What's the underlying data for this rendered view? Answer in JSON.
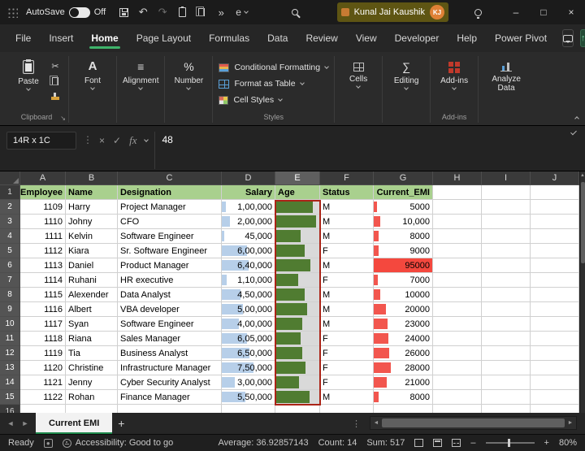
{
  "title_bar": {
    "autosave_label": "AutoSave",
    "autosave_state": "Off",
    "overflow_label": "e",
    "user_name": "Kunal Jai Kaushik",
    "user_initials": "KJ"
  },
  "menu": {
    "tabs": [
      "File",
      "Insert",
      "Home",
      "Page Layout",
      "Formulas",
      "Data",
      "Review",
      "View",
      "Developer",
      "Help",
      "Power Pivot"
    ],
    "active_index": 2
  },
  "ribbon": {
    "paste": "Paste",
    "font": "Font",
    "alignment": "Alignment",
    "number": "Number",
    "conditional_formatting": "Conditional Formatting",
    "format_as_table": "Format as Table",
    "cell_styles": "Cell Styles",
    "cells": "Cells",
    "editing": "Editing",
    "addins": "Add-ins",
    "analyze_data": "Analyze Data",
    "group_clipboard": "Clipboard",
    "group_styles": "Styles",
    "group_addins": "Add-ins"
  },
  "formula_bar": {
    "name_box": "14R x 1C",
    "fx_label": "fx",
    "value": "48"
  },
  "grid": {
    "columns": [
      "A",
      "B",
      "C",
      "D",
      "E",
      "F",
      "G",
      "H",
      "I",
      "J"
    ],
    "selected_column": "E",
    "selected_rows_from": 2,
    "selected_rows_to": 15,
    "header_row": [
      "Employee",
      "Name",
      "Designation",
      "Salary",
      "Age",
      "Status",
      "Current_EMI"
    ],
    "rows": [
      {
        "employee": "1109",
        "name": "Harry",
        "designation": "Project Manager",
        "salary": "1,00,000",
        "salary_bar": 8,
        "age_bar": 86,
        "status": "M",
        "emi": "5000",
        "emi_bar": 5
      },
      {
        "employee": "1110",
        "name": "Johny",
        "designation": "CFO",
        "salary": "2,00,000",
        "salary_bar": 16,
        "age_bar": 92,
        "status": "M",
        "emi": "10,000",
        "emi_bar": 11
      },
      {
        "employee": "1111",
        "name": "Kelvin",
        "designation": "Software Engineer",
        "salary": "45,000",
        "salary_bar": 4,
        "age_bar": 58,
        "status": "M",
        "emi": "8000",
        "emi_bar": 8
      },
      {
        "employee": "1112",
        "name": "Kiara",
        "designation": "Sr. Software Engineer",
        "salary": "6,00,000",
        "salary_bar": 48,
        "age_bar": 66,
        "status": "F",
        "emi": "9000",
        "emi_bar": 9
      },
      {
        "employee": "1113",
        "name": "Daniel",
        "designation": "Product Manager",
        "salary": "6,40,000",
        "salary_bar": 51,
        "age_bar": 80,
        "status": "M",
        "emi": "95000",
        "emi_bar": 100,
        "emi_full": true
      },
      {
        "employee": "1114",
        "name": "Ruhani",
        "designation": "HR executive",
        "salary": "1,10,000",
        "salary_bar": 9,
        "age_bar": 52,
        "status": "F",
        "emi": "7000",
        "emi_bar": 7
      },
      {
        "employee": "1115",
        "name": "Alexender",
        "designation": "Data Analyst",
        "salary": "4,50,000",
        "salary_bar": 36,
        "age_bar": 66,
        "status": "M",
        "emi": "10000",
        "emi_bar": 11
      },
      {
        "employee": "1116",
        "name": "Albert",
        "designation": "VBA developer",
        "salary": "5,00,000",
        "salary_bar": 40,
        "age_bar": 72,
        "status": "M",
        "emi": "20000",
        "emi_bar": 21
      },
      {
        "employee": "1117",
        "name": "Syan",
        "designation": "Software Engineer",
        "salary": "4,00,000",
        "salary_bar": 32,
        "age_bar": 62,
        "status": "M",
        "emi": "23000",
        "emi_bar": 24
      },
      {
        "employee": "1118",
        "name": "Riana",
        "designation": "Sales Manager",
        "salary": "6,05,000",
        "salary_bar": 48,
        "age_bar": 58,
        "status": "F",
        "emi": "24000",
        "emi_bar": 25
      },
      {
        "employee": "1119",
        "name": "Tia",
        "designation": "Business Analyst",
        "salary": "6,50,000",
        "salary_bar": 52,
        "age_bar": 62,
        "status": "F",
        "emi": "26000",
        "emi_bar": 27
      },
      {
        "employee": "1120",
        "name": "Christine",
        "designation": "Infrastructure Manager",
        "salary": "7,50,000",
        "salary_bar": 60,
        "age_bar": 68,
        "status": "F",
        "emi": "28000",
        "emi_bar": 29
      },
      {
        "employee": "1121",
        "name": "Jenny",
        "designation": "Cyber Security Analyst",
        "salary": "3,00,000",
        "salary_bar": 24,
        "age_bar": 54,
        "status": "F",
        "emi": "21000",
        "emi_bar": 22
      },
      {
        "employee": "1122",
        "name": "Rohan",
        "designation": "Finance Manager",
        "salary": "5,50,000",
        "salary_bar": 44,
        "age_bar": 78,
        "status": "M",
        "emi": "8000",
        "emi_bar": 8
      }
    ]
  },
  "sheet_bar": {
    "active_tab": "Current EMI"
  },
  "status_bar": {
    "mode": "Ready",
    "accessibility": "Accessibility: Good to go",
    "average": "Average: 36.92857143",
    "count": "Count: 14",
    "sum": "Sum: 517",
    "zoom": "80%"
  }
}
